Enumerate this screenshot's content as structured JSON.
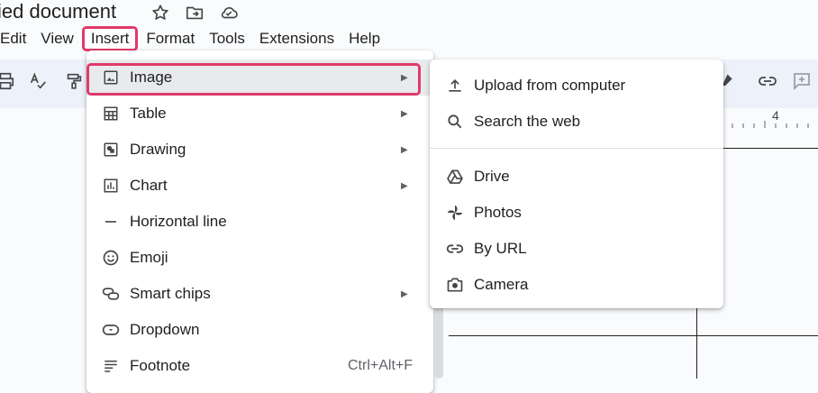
{
  "doc": {
    "title": "ied document",
    "title_icons": [
      "star-icon",
      "folder-move-icon",
      "cloud-saved-icon"
    ]
  },
  "menubar": {
    "items": [
      "Edit",
      "View",
      "Insert",
      "Format",
      "Tools",
      "Extensions",
      "Help"
    ],
    "active": "Insert"
  },
  "toolbar": {
    "icons": [
      "print-icon",
      "spellcheck-icon",
      "paint-format-icon",
      "highlight-icon",
      "link-icon",
      "add-comment-icon"
    ]
  },
  "ruler": {
    "number": "4"
  },
  "insert_menu": {
    "items": [
      {
        "label": "Image",
        "icon": "image-icon",
        "submenu": true,
        "highlighted": true
      },
      {
        "label": "Table",
        "icon": "table-icon",
        "submenu": true
      },
      {
        "label": "Drawing",
        "icon": "drawing-icon",
        "submenu": true
      },
      {
        "label": "Chart",
        "icon": "chart-icon",
        "submenu": true
      },
      {
        "label": "Horizontal line",
        "icon": "horizontal-line-icon",
        "submenu": false
      },
      {
        "label": "Emoji",
        "icon": "emoji-icon",
        "submenu": false
      },
      {
        "label": "Smart chips",
        "icon": "smart-chips-icon",
        "submenu": true
      },
      {
        "label": "Dropdown",
        "icon": "dropdown-icon",
        "submenu": false
      },
      {
        "label": "Footnote",
        "icon": "footnote-icon",
        "submenu": false,
        "shortcut": "Ctrl+Alt+F"
      }
    ]
  },
  "image_submenu": {
    "items": [
      {
        "label": "Upload from computer",
        "icon": "upload-icon"
      },
      {
        "label": "Search the web",
        "icon": "search-icon"
      },
      {
        "label": "Drive",
        "icon": "drive-icon"
      },
      {
        "label": "Photos",
        "icon": "photos-icon"
      },
      {
        "label": "By URL",
        "icon": "link-icon"
      },
      {
        "label": "Camera",
        "icon": "camera-icon"
      }
    ]
  },
  "colors": {
    "highlight_border": "#e03a6a",
    "toolbar_bg": "#edf2fa",
    "menu_hover": "#e8eaed"
  }
}
